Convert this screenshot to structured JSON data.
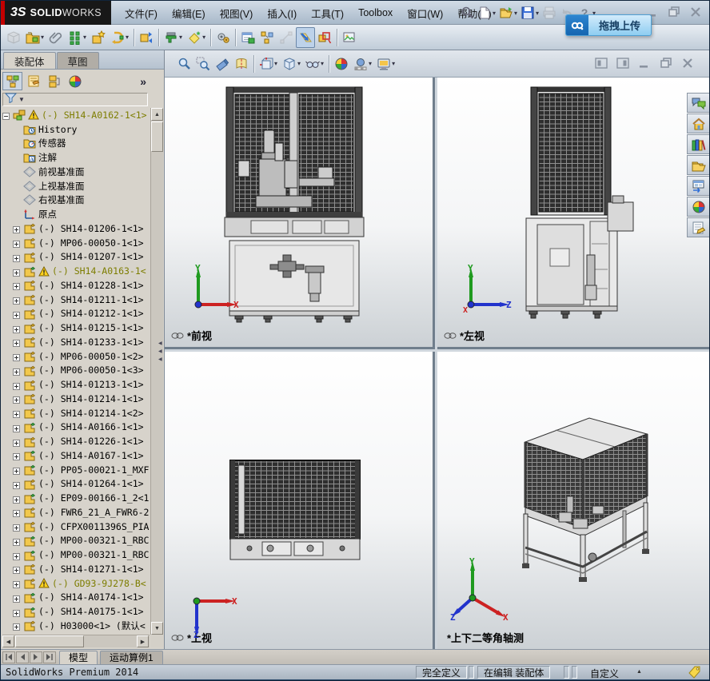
{
  "titlebar": {
    "logo_ds": "3S",
    "logo_solid": "SOLID",
    "logo_works": "WORKS",
    "menus": [
      "文件(F)",
      "编辑(E)",
      "视图(V)",
      "插入(I)",
      "工具(T)",
      "Toolbox",
      "窗口(W)",
      "帮助(H)"
    ],
    "quick_icons": [
      {
        "name": "search-icon",
        "kind": "search"
      },
      {
        "name": "new-document-icon",
        "kind": "page",
        "dropdown": true
      },
      {
        "name": "open-icon",
        "kind": "open",
        "dropdown": true
      },
      {
        "name": "save-icon",
        "kind": "save",
        "dropdown": true
      },
      {
        "name": "print-icon",
        "kind": "print",
        "disabled": true
      },
      {
        "name": "undo-icon",
        "kind": "undo",
        "disabled": true
      },
      {
        "name": "help-icon",
        "kind": "help",
        "dropdown": true
      }
    ],
    "overlay_label": "拖拽上传"
  },
  "toolbar": {
    "icons": [
      {
        "name": "insert-component-icon",
        "kind": "cube-gray",
        "disabled": true
      },
      {
        "name": "insert-components-icon",
        "kind": "folder-part",
        "dropdown": true
      },
      {
        "name": "mate-icon",
        "kind": "paperclip"
      },
      {
        "name": "linear-component-pattern-icon",
        "kind": "green-dots",
        "dropdown": true
      },
      {
        "name": "smart-fasteners-icon",
        "kind": "box-star"
      },
      {
        "name": "move-component-icon",
        "kind": "move-d",
        "dropdown": true
      },
      {
        "name": "show-hidden-components-icon",
        "kind": "show-hidden",
        "sep": true
      },
      {
        "name": "assembly-features-icon",
        "kind": "anvil",
        "dropdown": true,
        "sep": true
      },
      {
        "name": "reference-geometry-icon",
        "kind": "ref-geom",
        "dropdown": true
      },
      {
        "name": "new-motion-study-icon",
        "kind": "gears",
        "sep": true
      },
      {
        "name": "bill-of-materials-icon",
        "kind": "bom",
        "sep": true
      },
      {
        "name": "exploded-view-icon",
        "kind": "explode"
      },
      {
        "name": "explode-line-sketch-icon",
        "kind": "explode-sketch",
        "disabled": true
      },
      {
        "name": "large-design-review-icon",
        "kind": "slant-arrow",
        "pressed": true
      },
      {
        "name": "interference-detection-icon",
        "kind": "interference"
      },
      {
        "name": "screen-capture-icon",
        "kind": "image",
        "sep": true
      }
    ]
  },
  "left_panel": {
    "tabs": [
      {
        "label": "装配体",
        "active": true
      },
      {
        "label": "草图",
        "active": false
      }
    ],
    "fm_icons": [
      {
        "name": "featuremanager-tree-tab-icon",
        "kind": "asm-tree",
        "active": true
      },
      {
        "name": "propertymanager-tab-icon",
        "kind": "prop"
      },
      {
        "name": "configurationmanager-tab-icon",
        "kind": "config"
      },
      {
        "name": "displaymanager-tab-icon",
        "kind": "sphere"
      }
    ],
    "fm_chevron": "»",
    "tree": [
      {
        "label": "(-) SH14-A0162-1<1>",
        "icon": "asm-root",
        "warn": true,
        "olive": true,
        "expand": "minus",
        "root": true
      },
      {
        "label": "History",
        "icon": "folder-history"
      },
      {
        "label": "传感器",
        "icon": "folder-sensor"
      },
      {
        "label": "注解",
        "icon": "folder-note"
      },
      {
        "label": "前视基准面",
        "icon": "plane"
      },
      {
        "label": "上视基准面",
        "icon": "plane"
      },
      {
        "label": "右视基准面",
        "icon": "plane"
      },
      {
        "label": "原点",
        "icon": "origin"
      },
      {
        "label": "(-) SH14-01206-1<1>",
        "icon": "part",
        "expand": "plus"
      },
      {
        "label": "(-) MP06-00050-1<1>",
        "icon": "part",
        "expand": "plus"
      },
      {
        "label": "(-) SH14-01207-1<1>",
        "icon": "part",
        "expand": "plus"
      },
      {
        "label": "(-) SH14-A0163-1<",
        "icon": "part-green",
        "warn": true,
        "olive": true,
        "expand": "plus"
      },
      {
        "label": "(-) SH14-01228-1<1>",
        "icon": "part",
        "expand": "plus"
      },
      {
        "label": "(-) SH14-01211-1<1>",
        "icon": "part",
        "expand": "plus"
      },
      {
        "label": "(-) SH14-01212-1<1>",
        "icon": "part",
        "expand": "plus"
      },
      {
        "label": "(-) SH14-01215-1<1>",
        "icon": "part",
        "expand": "plus"
      },
      {
        "label": "(-) SH14-01233-1<1>",
        "icon": "part",
        "expand": "plus"
      },
      {
        "label": "(-) MP06-00050-1<2>",
        "icon": "part",
        "expand": "plus"
      },
      {
        "label": "(-) MP06-00050-1<3>",
        "icon": "part",
        "expand": "plus"
      },
      {
        "label": "(-) SH14-01213-1<1>",
        "icon": "part",
        "expand": "plus"
      },
      {
        "label": "(-) SH14-01214-1<1>",
        "icon": "part",
        "expand": "plus"
      },
      {
        "label": "(-) SH14-01214-1<2>",
        "icon": "part",
        "expand": "plus"
      },
      {
        "label": "(-) SH14-A0166-1<1>",
        "icon": "part-green",
        "expand": "plus"
      },
      {
        "label": "(-) SH14-01226-1<1>",
        "icon": "part",
        "expand": "plus"
      },
      {
        "label": "(-) SH14-A0167-1<1>",
        "icon": "part-green",
        "expand": "plus"
      },
      {
        "label": "(-) PP05-00021-1_MXF",
        "icon": "part-green",
        "expand": "plus"
      },
      {
        "label": "(-) SH14-01264-1<1>",
        "icon": "part",
        "expand": "plus"
      },
      {
        "label": "(-) EP09-00166-1_2<1",
        "icon": "part-green",
        "expand": "plus"
      },
      {
        "label": "(-) FWR6_21_A_FWR6-2",
        "icon": "part",
        "expand": "plus"
      },
      {
        "label": "(-) CFPX0011396S_PIA",
        "icon": "part",
        "expand": "plus"
      },
      {
        "label": "(-) MP00-00321-1_RBC",
        "icon": "part-green",
        "expand": "plus"
      },
      {
        "label": "(-) MP00-00321-1_RBC",
        "icon": "part-green",
        "expand": "plus"
      },
      {
        "label": "(-) SH14-01271-1<1>",
        "icon": "part",
        "expand": "plus"
      },
      {
        "label": "(-) GD93-9J278-B<",
        "icon": "part",
        "warn": true,
        "olive": true,
        "expand": "plus"
      },
      {
        "label": "(-) SH14-A0174-1<1>",
        "icon": "part-green",
        "expand": "plus"
      },
      {
        "label": "(-) SH14-A0175-1<1>",
        "icon": "part-green",
        "expand": "plus"
      },
      {
        "label": "(-) H03000<1> (默认<",
        "icon": "part",
        "expand": "plus"
      }
    ],
    "model_tabs": [
      {
        "label": "模型",
        "active": true
      },
      {
        "label": "运动算例1",
        "active": false
      }
    ]
  },
  "doc": {
    "headsup_icons": [
      {
        "name": "zoom-to-fit-icon",
        "kind": "magnifier"
      },
      {
        "name": "zoom-to-area-icon",
        "kind": "magnifier-area"
      },
      {
        "name": "previous-view-icon",
        "kind": "telescope"
      },
      {
        "name": "section-view-icon",
        "kind": "section"
      },
      {
        "name": "view-orientation-icon",
        "kind": "view-cube",
        "dropdown": true,
        "sep": true
      },
      {
        "name": "display-style-icon",
        "kind": "cube",
        "dropdown": true
      },
      {
        "name": "hide-show-items-icon",
        "kind": "glasses",
        "dropdown": true
      },
      {
        "name": "edit-appearance-icon",
        "kind": "sphere",
        "sep": true
      },
      {
        "name": "apply-scene-icon",
        "kind": "scene",
        "dropdown": true
      },
      {
        "name": "view-settings-icon",
        "kind": "monitor",
        "dropdown": true
      }
    ],
    "doc_controls": [
      {
        "name": "pane-previous-icon",
        "kind": "pane-left"
      },
      {
        "name": "pane-next-icon",
        "kind": "pane-right"
      },
      {
        "name": "doc-minimize-icon",
        "kind": "dash"
      },
      {
        "name": "doc-restore-icon",
        "kind": "restore"
      },
      {
        "name": "doc-close-icon",
        "kind": "close-x"
      }
    ],
    "taskpane_icons": [
      {
        "name": "solidworks-forum-icon",
        "kind": "forum"
      },
      {
        "name": "solidworks-resources-icon",
        "kind": "home"
      },
      {
        "name": "design-library-icon",
        "kind": "design-library"
      },
      {
        "name": "file-explorer-icon",
        "kind": "file-explorer"
      },
      {
        "name": "view-palette-icon",
        "kind": "view-palette"
      },
      {
        "name": "appearances-scenes-icon",
        "kind": "sphere"
      },
      {
        "name": "custom-properties-icon",
        "kind": "custom-properties"
      }
    ],
    "viewports": [
      {
        "label": "*前视",
        "linked": true,
        "origin_dot": "#2233cc",
        "axes": [
          {
            "dir": "up",
            "label": "Y",
            "color": "#1f9a1f"
          },
          {
            "dir": "right",
            "label": "X",
            "color": "#cc2222"
          }
        ]
      },
      {
        "label": "*左视",
        "linked": true,
        "origin_dot": "#2233cc",
        "origin_label": "X",
        "origin_label_color": "#cc2222",
        "axes": [
          {
            "dir": "up",
            "label": "Y",
            "color": "#1f9a1f"
          },
          {
            "dir": "right",
            "label": "Z",
            "color": "#2233cc"
          }
        ]
      },
      {
        "label": "*上视",
        "linked": true,
        "origin_dot": "#1f9a1f",
        "axes": [
          {
            "dir": "right",
            "label": "X",
            "color": "#cc2222"
          },
          {
            "dir": "down",
            "label": "Z",
            "color": "#2233cc"
          }
        ]
      },
      {
        "label": "*上下二等角轴测",
        "linked": false,
        "origin_dot": "#1f9a1f",
        "axes": [
          {
            "dir": "up",
            "label": "Y",
            "color": "#1f9a1f"
          },
          {
            "dir": "dr",
            "label": "X",
            "color": "#cc2222"
          },
          {
            "dir": "dl",
            "label": "Z",
            "color": "#2233cc"
          }
        ]
      }
    ]
  },
  "statusbar": {
    "left": "SolidWorks Premium 2014",
    "cells": [
      {
        "label": "完全定义"
      },
      {
        "label": "在编辑 装配体"
      }
    ],
    "custom": "自定义"
  },
  "colors": {
    "chrome_blue": "#aebfd0",
    "panel_gray": "#d7d3cb",
    "warning_olive": "#7d7d00",
    "overlay_blue": "#1565b0",
    "mesh_dark": "#2e2e2e"
  }
}
